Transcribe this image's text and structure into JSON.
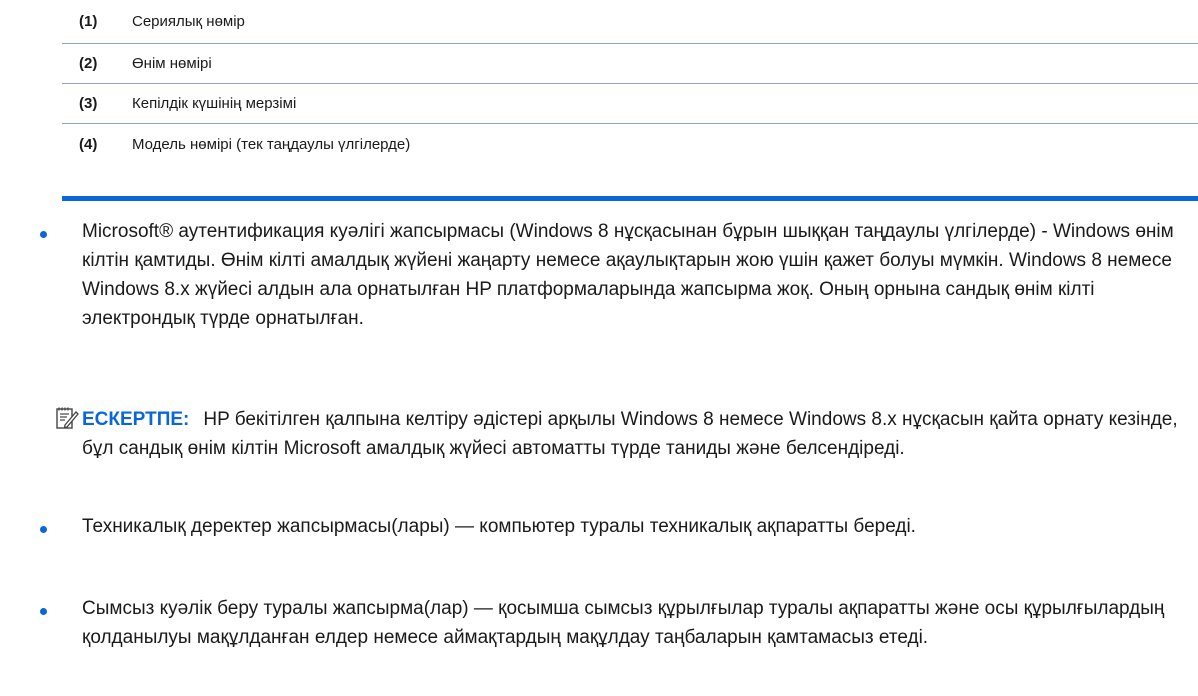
{
  "table": {
    "rows": [
      {
        "num": "(1)",
        "text": "Сериялық нөмір"
      },
      {
        "num": "(2)",
        "text": "Өнім нөмірі"
      },
      {
        "num": "(3)",
        "text": "Кепілдік күшінің мерзімі"
      },
      {
        "num": "(4)",
        "text": "Модель нөмірі (тек таңдаулы үлгілерде)"
      }
    ]
  },
  "bullets": [
    "Microsoft® аутентификация куәлігі жапсырмасы (Windows 8 нұсқасынан бұрын шыққан таңдаулы үлгілерде) - Windows өнім кілтін қамтиды. Өнім кілті амалдық жүйені жаңарту немесе ақаулықтарын жою үшін қажет болуы мүмкін. Windows 8 немесе Windows 8.x жүйесі алдын ала орнатылған HP платформаларында жапсырма жоқ. Оның орнына сандық өнім кілті электрондық түрде орнатылған.",
    "Техникалық деректер жапсырмасы(лары) — компьютер туралы техникалық ақпаратты береді.",
    "Сымсыз куәлік беру туралы жапсырма(лар) — қосымша сымсыз құрылғылар туралы ақпаратты және осы құрылғылардың қолданылуы мақұлданған елдер немесе аймақтардың мақұлдау таңбаларын қамтамасыз етеді."
  ],
  "note": {
    "label": "ЕСКЕРТПЕ:",
    "text": "HP бекітілген қалпына келтіру әдістері арқылы Windows 8 немесе Windows 8.x нұсқасын қайта орнату кезінде, бұл сандық өнім кілтін Microsoft амалдық жүйесі автоматты түрде таниды және белсендіреді."
  },
  "colors": {
    "accent": "#0b66d8",
    "rule": "#8fa4c9",
    "text": "#1a1a1a"
  },
  "icons": [
    "note-icon"
  ]
}
